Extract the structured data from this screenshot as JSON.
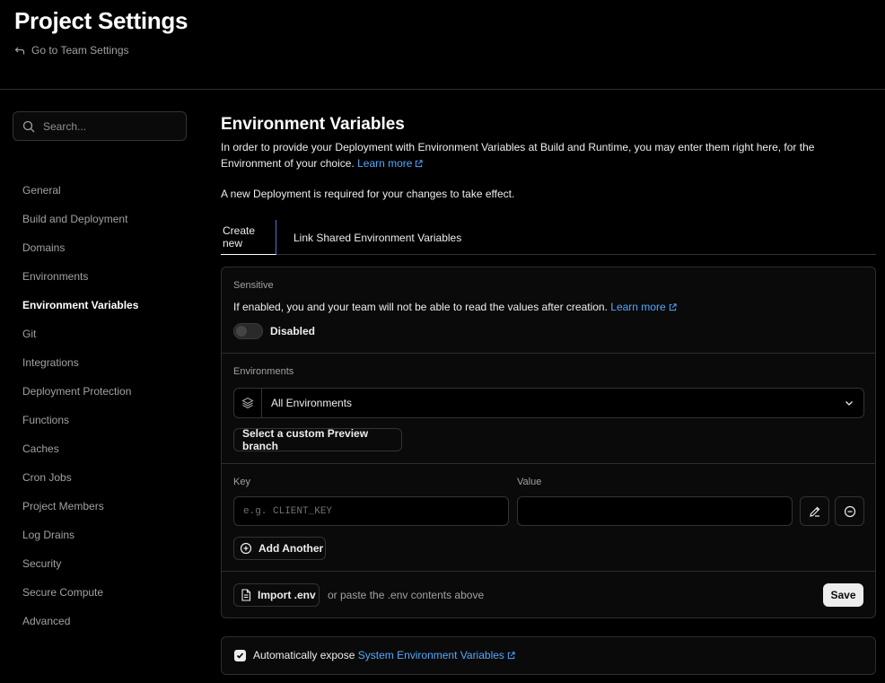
{
  "header": {
    "title": "Project Settings",
    "back_label": "Go to Team Settings"
  },
  "sidebar": {
    "search_placeholder": "Search...",
    "items": [
      {
        "label": "General"
      },
      {
        "label": "Build and Deployment"
      },
      {
        "label": "Domains"
      },
      {
        "label": "Environments"
      },
      {
        "label": "Environment Variables",
        "active": true
      },
      {
        "label": "Git"
      },
      {
        "label": "Integrations"
      },
      {
        "label": "Deployment Protection"
      },
      {
        "label": "Functions"
      },
      {
        "label": "Caches"
      },
      {
        "label": "Cron Jobs"
      },
      {
        "label": "Project Members"
      },
      {
        "label": "Log Drains"
      },
      {
        "label": "Security"
      },
      {
        "label": "Secure Compute"
      },
      {
        "label": "Advanced"
      }
    ]
  },
  "main": {
    "title": "Environment Variables",
    "description": "In order to provide your Deployment with Environment Variables at Build and Runtime, you may enter them right here, for the Environment of your choice.",
    "learn_more": "Learn more",
    "note": "A new Deployment is required for your changes to take effect.",
    "tabs": [
      {
        "label": "Create new",
        "active": true
      },
      {
        "label": "Link Shared Environment Variables"
      }
    ]
  },
  "form": {
    "sensitive_label": "Sensitive",
    "sensitive_desc": "If enabled, you and your team will not be able to read the values after creation.",
    "sensitive_learn_more": "Learn more",
    "toggle_state": "Disabled",
    "environments_label": "Environments",
    "environments_value": "All Environments",
    "custom_branch_label": "Select a custom Preview branch",
    "key_label": "Key",
    "key_placeholder": "e.g. CLIENT_KEY",
    "value_label": "Value",
    "value_value": "",
    "add_another_label": "Add Another",
    "import_label": "Import .env",
    "paste_hint": "or paste the .env contents above",
    "save_label": "Save"
  },
  "system_vars": {
    "checked": true,
    "prefix": "Automatically expose",
    "link": "System Environment Variables"
  },
  "colors": {
    "background": "#000000",
    "card": "#0a0a0a",
    "border": "#2e2e2e",
    "link": "#52a8ff",
    "tab_indicator": "#5b6be0"
  }
}
